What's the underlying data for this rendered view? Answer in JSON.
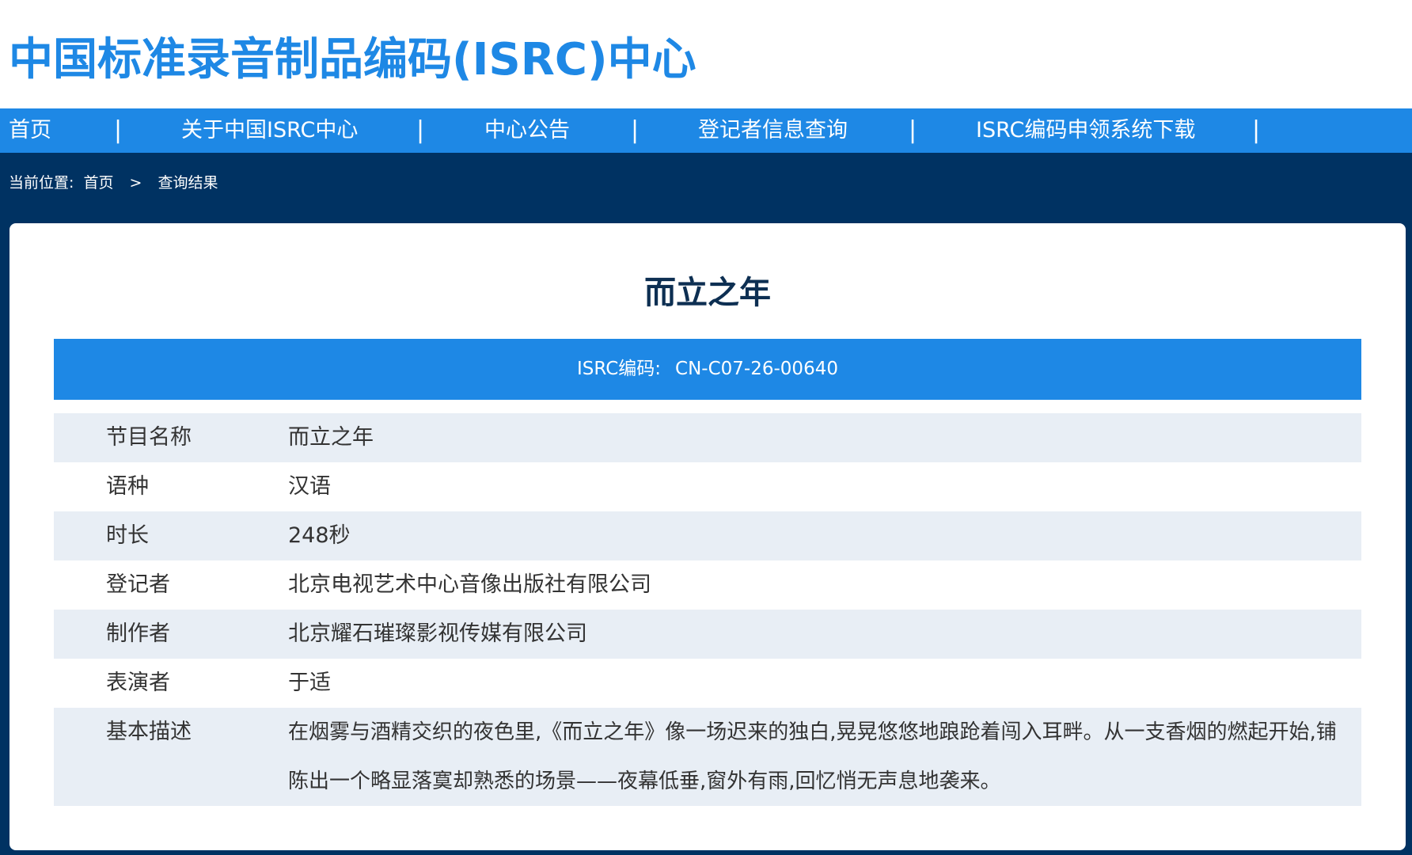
{
  "header": {
    "site_title": "中国标准录音制品编码(ISRC)中心"
  },
  "nav": {
    "items": [
      {
        "label": "首页"
      },
      {
        "label": "关于中国ISRC中心"
      },
      {
        "label": "中心公告"
      },
      {
        "label": "登记者信息查询"
      },
      {
        "label": "ISRC编码申领系统下载"
      }
    ],
    "separator": "|"
  },
  "breadcrumb": {
    "prefix": "当前位置:",
    "home": "首页",
    "separator": ">",
    "current": "查询结果"
  },
  "record": {
    "title": "而立之年",
    "isrc_label": "ISRC编码:",
    "isrc_code": "CN-C07-26-00640",
    "fields": [
      {
        "label": "节目名称",
        "value": "而立之年"
      },
      {
        "label": "语种",
        "value": "汉语"
      },
      {
        "label": "时长",
        "value": "248秒"
      },
      {
        "label": "登记者",
        "value": "北京电视艺术中心音像出版社有限公司"
      },
      {
        "label": "制作者",
        "value": "北京耀石璀璨影视传媒有限公司"
      },
      {
        "label": "表演者",
        "value": "于适"
      },
      {
        "label": "基本描述",
        "value": "在烟雾与酒精交织的夜色里,《而立之年》像一场迟来的独白,晃晃悠悠地踉跄着闯入耳畔。从一支香烟的燃起开始,铺陈出一个略显落寞却熟悉的场景——夜幕低垂,窗外有雨,回忆悄无声息地袭来。"
      }
    ]
  },
  "colors": {
    "brand_blue": "#1e88e5",
    "navy": "#003262",
    "row_shade": "#e8eef5",
    "title_text": "#0d2f52"
  }
}
